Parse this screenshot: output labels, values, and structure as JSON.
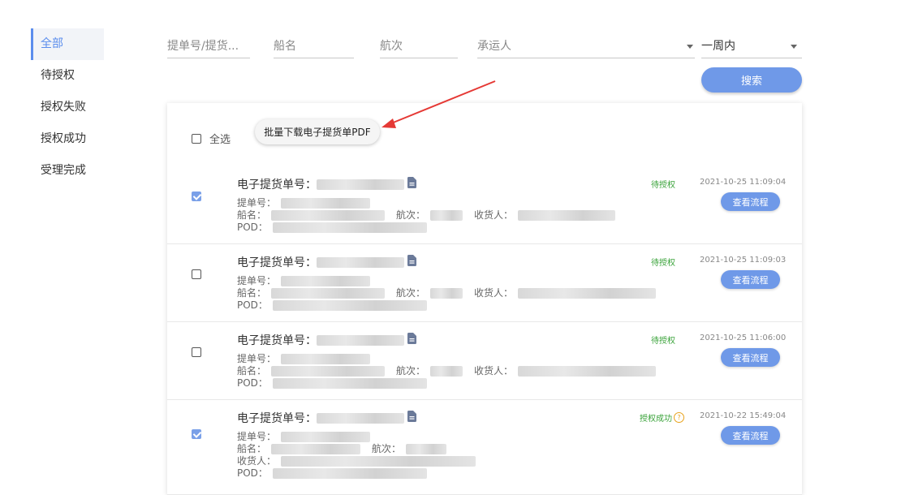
{
  "sidebar": {
    "items": [
      {
        "label": "全部",
        "active": true
      },
      {
        "label": "待授权",
        "active": false
      },
      {
        "label": "授权失败",
        "active": false
      },
      {
        "label": "授权成功",
        "active": false
      },
      {
        "label": "受理完成",
        "active": false
      }
    ]
  },
  "filters": {
    "bl_placeholder": "提单号/提货...",
    "ship_placeholder": "船名",
    "voyage_placeholder": "航次",
    "carrier_placeholder": "承运人",
    "period_value": "一周内",
    "search_label": "搜索"
  },
  "toolbar": {
    "select_all_label": "全选",
    "batch_download_label": "批量下载电子提货单PDF"
  },
  "labels": {
    "ebl_no": "电子提货单号：",
    "bl_no": "提单号：",
    "ship": "船名：",
    "voyage": "航次：",
    "consignee": "收货人：",
    "pod": "POD："
  },
  "records": [
    {
      "checked": true,
      "status": "待授权",
      "status_help": false,
      "time": "2021-10-25 11:09:04",
      "action": "查看流程"
    },
    {
      "checked": false,
      "status": "待授权",
      "status_help": false,
      "time": "2021-10-25 11:09:03",
      "action": "查看流程"
    },
    {
      "checked": false,
      "status": "待授权",
      "status_help": false,
      "time": "2021-10-25 11:06:00",
      "action": "查看流程"
    },
    {
      "checked": true,
      "status": "授权成功",
      "status_help": true,
      "time": "2021-10-22 15:49:04",
      "action": "查看流程"
    }
  ],
  "colors": {
    "accent": "#6f99e8",
    "status_green": "#3aa33a",
    "help_orange": "#e8a21b",
    "arrow_red": "#e53935"
  },
  "icons": [
    "document-icon",
    "help-circle-icon",
    "chevron-down-icon",
    "checkbox-icon"
  ]
}
